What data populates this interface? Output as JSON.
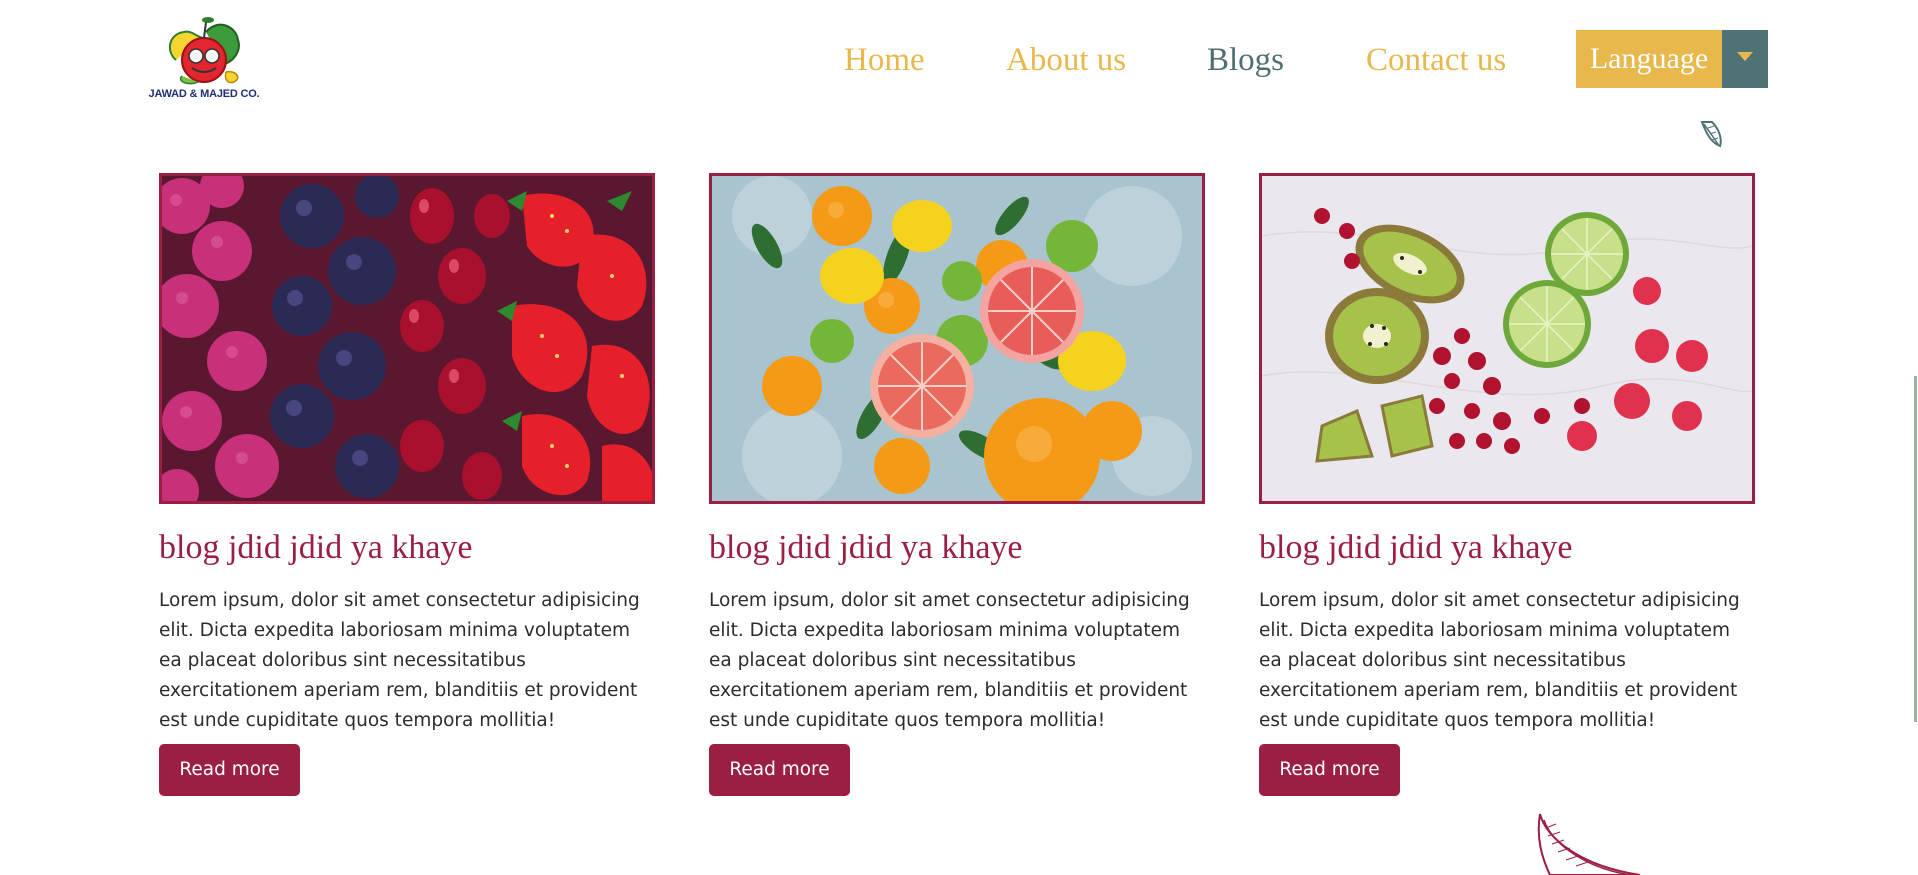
{
  "brand": {
    "logo_text": "JAWAD & MAJED CO."
  },
  "nav": {
    "items": [
      {
        "label": "Home"
      },
      {
        "label": "About us"
      },
      {
        "label": "Blogs"
      },
      {
        "label": "Contact us"
      }
    ],
    "active": "Blogs",
    "language_button": "Language"
  },
  "colors": {
    "accent_gold": "#e8b84d",
    "accent_teal": "#4f7274",
    "brand_crimson": "#9b1f43"
  },
  "blogs": [
    {
      "image": "berries-photo",
      "title": "blog jdid jdid ya khaye",
      "body": "Lorem ipsum, dolor sit amet consectetur adipisicing elit. Dicta expedita laboriosam minima voluptatem ea placeat doloribus sint necessitatibus exercitationem aperiam rem, blanditiis et provident est unde cupiditate quos tempora mollitia!",
      "button": "Read more"
    },
    {
      "image": "citrus-photo",
      "title": "blog jdid jdid ya khaye",
      "body": "Lorem ipsum, dolor sit amet consectetur adipisicing elit. Dicta expedita laboriosam minima voluptatem ea placeat doloribus sint necessitatibus exercitationem aperiam rem, blanditiis et provident est unde cupiditate quos tempora mollitia!",
      "button": "Read more"
    },
    {
      "image": "kiwi-lime-berries-photo",
      "title": "blog jdid jdid ya khaye",
      "body": "Lorem ipsum, dolor sit amet consectetur adipisicing elit. Dicta expedita laboriosam minima voluptatem ea placeat doloribus sint necessitatibus exercitationem aperiam rem, blanditiis et provident est unde cupiditate quos tempora mollitia!",
      "button": "Read more"
    }
  ]
}
